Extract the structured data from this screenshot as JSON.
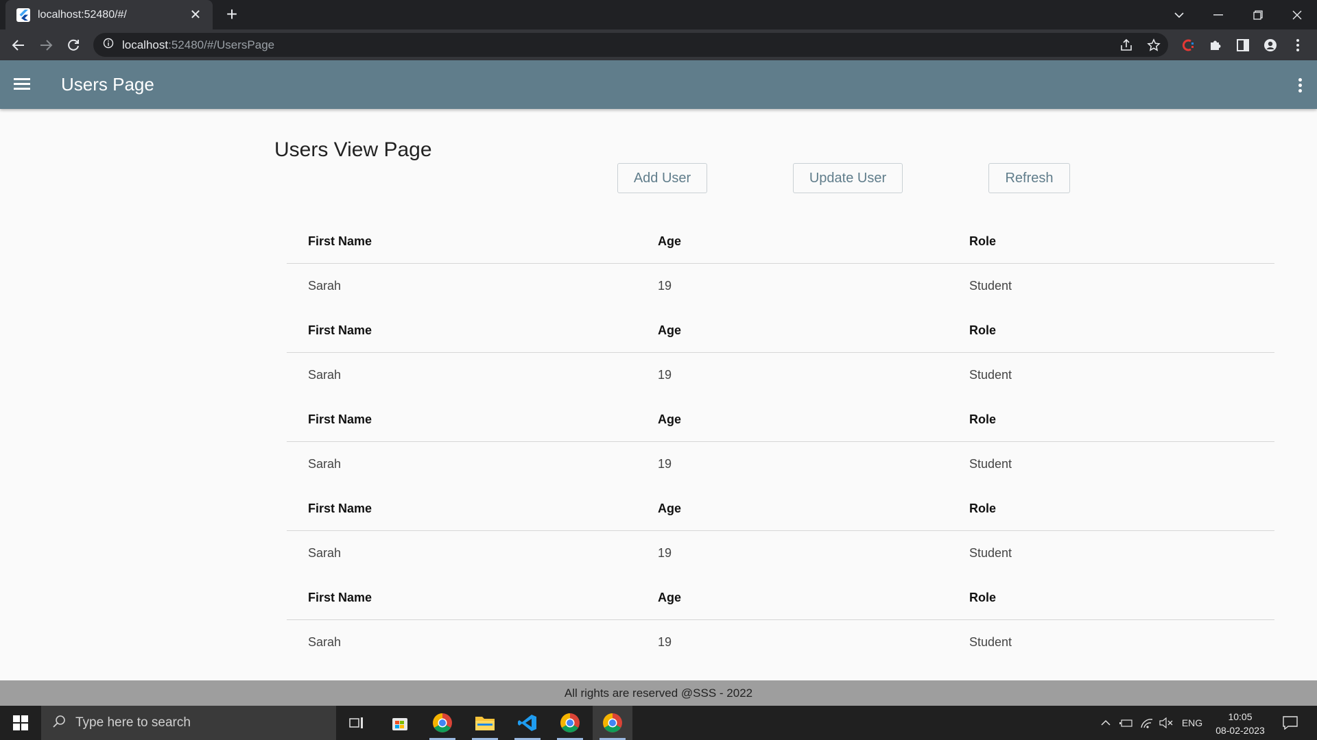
{
  "browser": {
    "tab_title": "localhost:52480/#/",
    "url_host": "localhost",
    "url_rest": ":52480/#/UsersPage"
  },
  "appbar": {
    "title": "Users Page"
  },
  "page": {
    "heading": "Users View Page",
    "buttons": {
      "add": "Add User",
      "update": "Update User",
      "refresh": "Refresh"
    }
  },
  "table": {
    "headers": [
      "First Name",
      "Age",
      "Role"
    ],
    "groups": [
      {
        "first_name": "Sarah",
        "age": "19",
        "role": "Student"
      },
      {
        "first_name": "Sarah",
        "age": "19",
        "role": "Student"
      },
      {
        "first_name": "Sarah",
        "age": "19",
        "role": "Student"
      },
      {
        "first_name": "Sarah",
        "age": "19",
        "role": "Student"
      },
      {
        "first_name": "Sarah",
        "age": "19",
        "role": "Student"
      }
    ]
  },
  "footer": {
    "text": "All rights are reserved @SSS - 2022"
  },
  "taskbar": {
    "search_placeholder": "Type here to search",
    "language": "ENG",
    "time": "10:05",
    "date": "08-02-2023"
  },
  "colors": {
    "appbar": "#607d8b",
    "footer": "#9e9e9e",
    "button_text": "#607d8b"
  }
}
